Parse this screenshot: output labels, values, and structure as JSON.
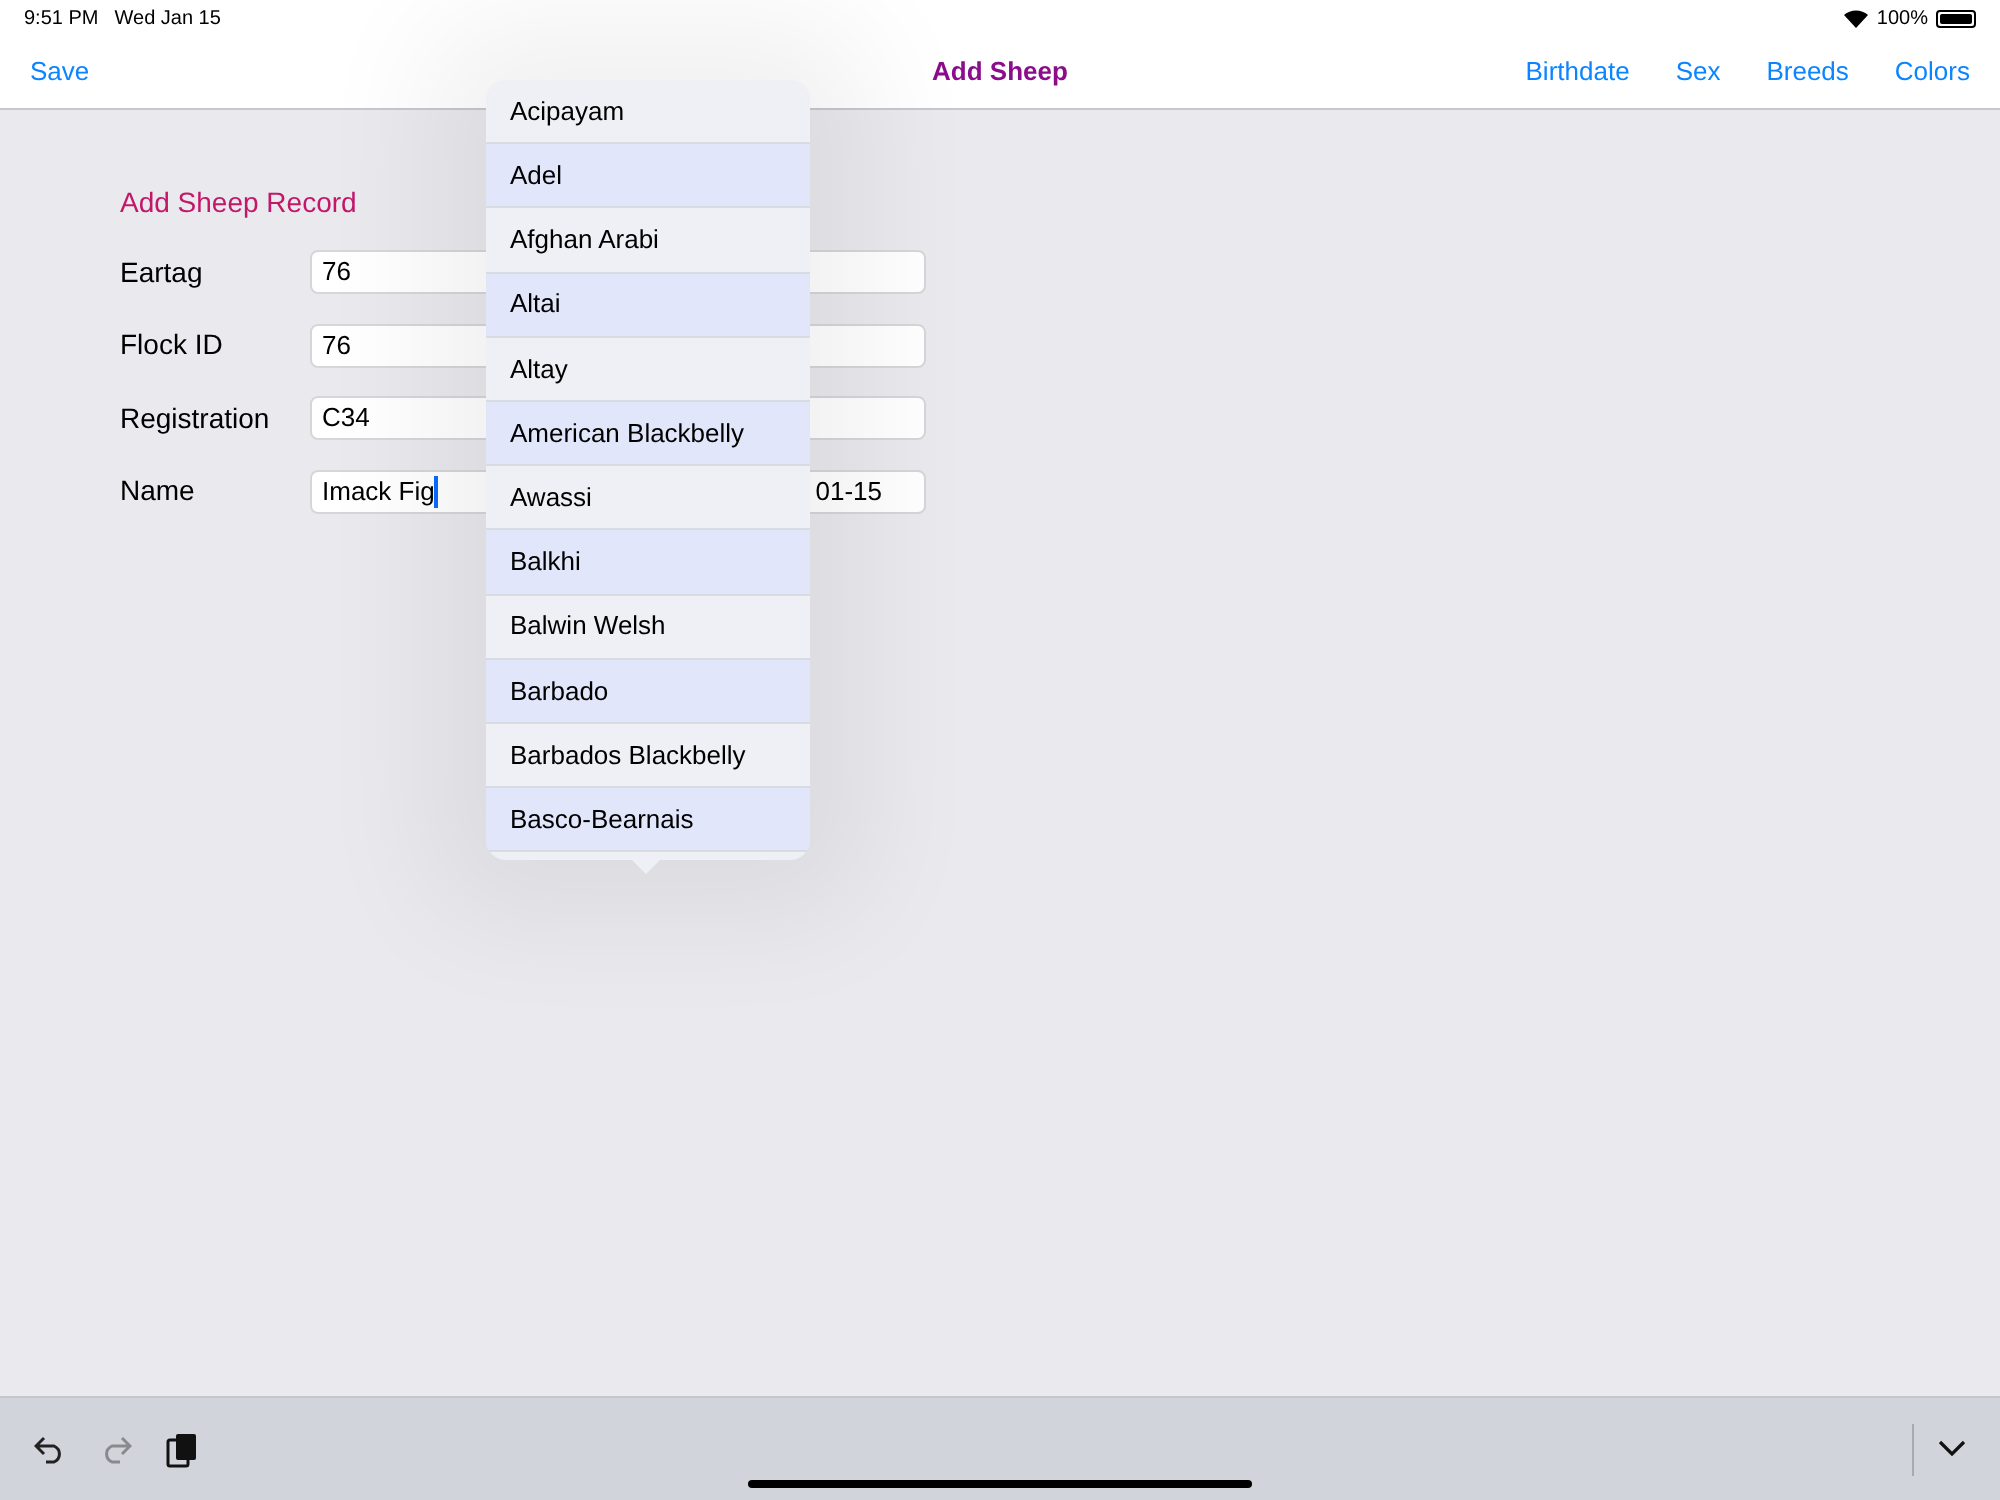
{
  "status_bar": {
    "time": "9:51 PM",
    "date": "Wed Jan 15",
    "battery": "100%"
  },
  "nav": {
    "left": "Save",
    "title": "Add Sheep",
    "right": [
      "Birthdate",
      "Sex",
      "Breeds",
      "Colors"
    ]
  },
  "form": {
    "heading": "Add Sheep Record",
    "fields": [
      {
        "label": "Eartag",
        "value": "76"
      },
      {
        "label": "Flock ID",
        "value": "76"
      },
      {
        "label": "Registration",
        "value": "C34"
      },
      {
        "label": "Name",
        "value": "Imack Fig",
        "focused": true,
        "extra": "01-15"
      }
    ]
  },
  "breeds_popover": {
    "items": [
      "Acipayam",
      "Adel",
      "Afghan Arabi",
      "Altai",
      "Altay",
      "American Blackbelly",
      "Awassi",
      "Balkhi",
      "Balwin Welsh",
      "Barbado",
      "Barbados Blackbelly",
      "Basco-Bearnais"
    ]
  }
}
